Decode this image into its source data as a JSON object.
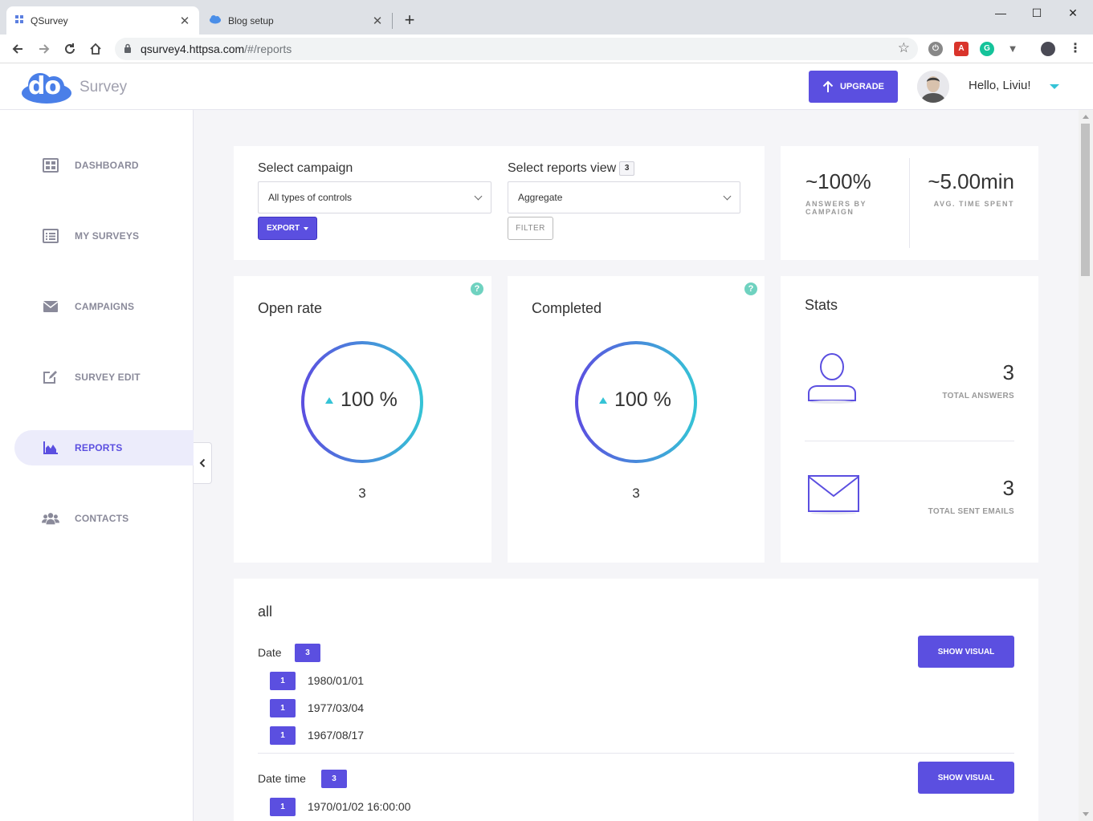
{
  "browser": {
    "tabs": [
      {
        "title": "QSurvey",
        "active": true
      },
      {
        "title": "Blog setup",
        "active": false
      }
    ],
    "url_host": "qsurvey4.httpsa.com",
    "url_path": "/#/reports",
    "window_controls": {
      "minimize": "—",
      "maximize": "☐",
      "close": "✕"
    }
  },
  "header": {
    "logo_text": "do",
    "brand": "Survey",
    "upgrade_label": "UPGRADE",
    "greeting": "Hello, Liviu!"
  },
  "sidebar": {
    "items": [
      {
        "label": "DASHBOARD",
        "icon": "dashboard-icon",
        "active": false
      },
      {
        "label": "MY SURVEYS",
        "icon": "list-icon",
        "active": false
      },
      {
        "label": "CAMPAIGNS",
        "icon": "envelope-icon",
        "active": false
      },
      {
        "label": "SURVEY EDIT",
        "icon": "edit-icon",
        "active": false
      },
      {
        "label": "REPORTS",
        "icon": "area-chart-icon",
        "active": true
      },
      {
        "label": "CONTACTS",
        "icon": "users-icon",
        "active": false
      }
    ]
  },
  "filters": {
    "campaign_label": "Select campaign",
    "campaign_value": "All types of controls",
    "view_label": "Select reports view",
    "view_count": "3",
    "view_value": "Aggregate",
    "export_label": "EXPORT",
    "filter_label": "FILTER"
  },
  "kpis": {
    "answers_value": "~100%",
    "answers_label_1": "ANSWERS BY",
    "answers_label_2": "CAMPAIGN",
    "time_value": "~5.00min",
    "time_label": "AVG. TIME SPENT"
  },
  "open_rate": {
    "title": "Open rate",
    "percent": "100 %",
    "count": "3",
    "fill": 1.0
  },
  "completed": {
    "title": "Completed",
    "percent": "100 %",
    "count": "3",
    "fill": 1.0
  },
  "stats": {
    "title": "Stats",
    "total_answers_value": "3",
    "total_answers_label": "TOTAL ANSWERS",
    "total_emails_value": "3",
    "total_emails_label": "TOTAL SENT EMAILS"
  },
  "report": {
    "title": "all",
    "show_visual_label": "SHOW VISUAL",
    "fields": [
      {
        "name": "Date",
        "count": "3",
        "rows": [
          {
            "count": "1",
            "value": "1980/01/01"
          },
          {
            "count": "1",
            "value": "1977/03/04"
          },
          {
            "count": "1",
            "value": "1967/08/17"
          }
        ]
      },
      {
        "name": "Date time",
        "count": "3",
        "rows": [
          {
            "count": "1",
            "value": "1970/01/02 16:00:00"
          }
        ]
      }
    ]
  },
  "colors": {
    "accent": "#5b4fe0",
    "teal": "#35c3d6",
    "help": "#6fd2c0"
  }
}
